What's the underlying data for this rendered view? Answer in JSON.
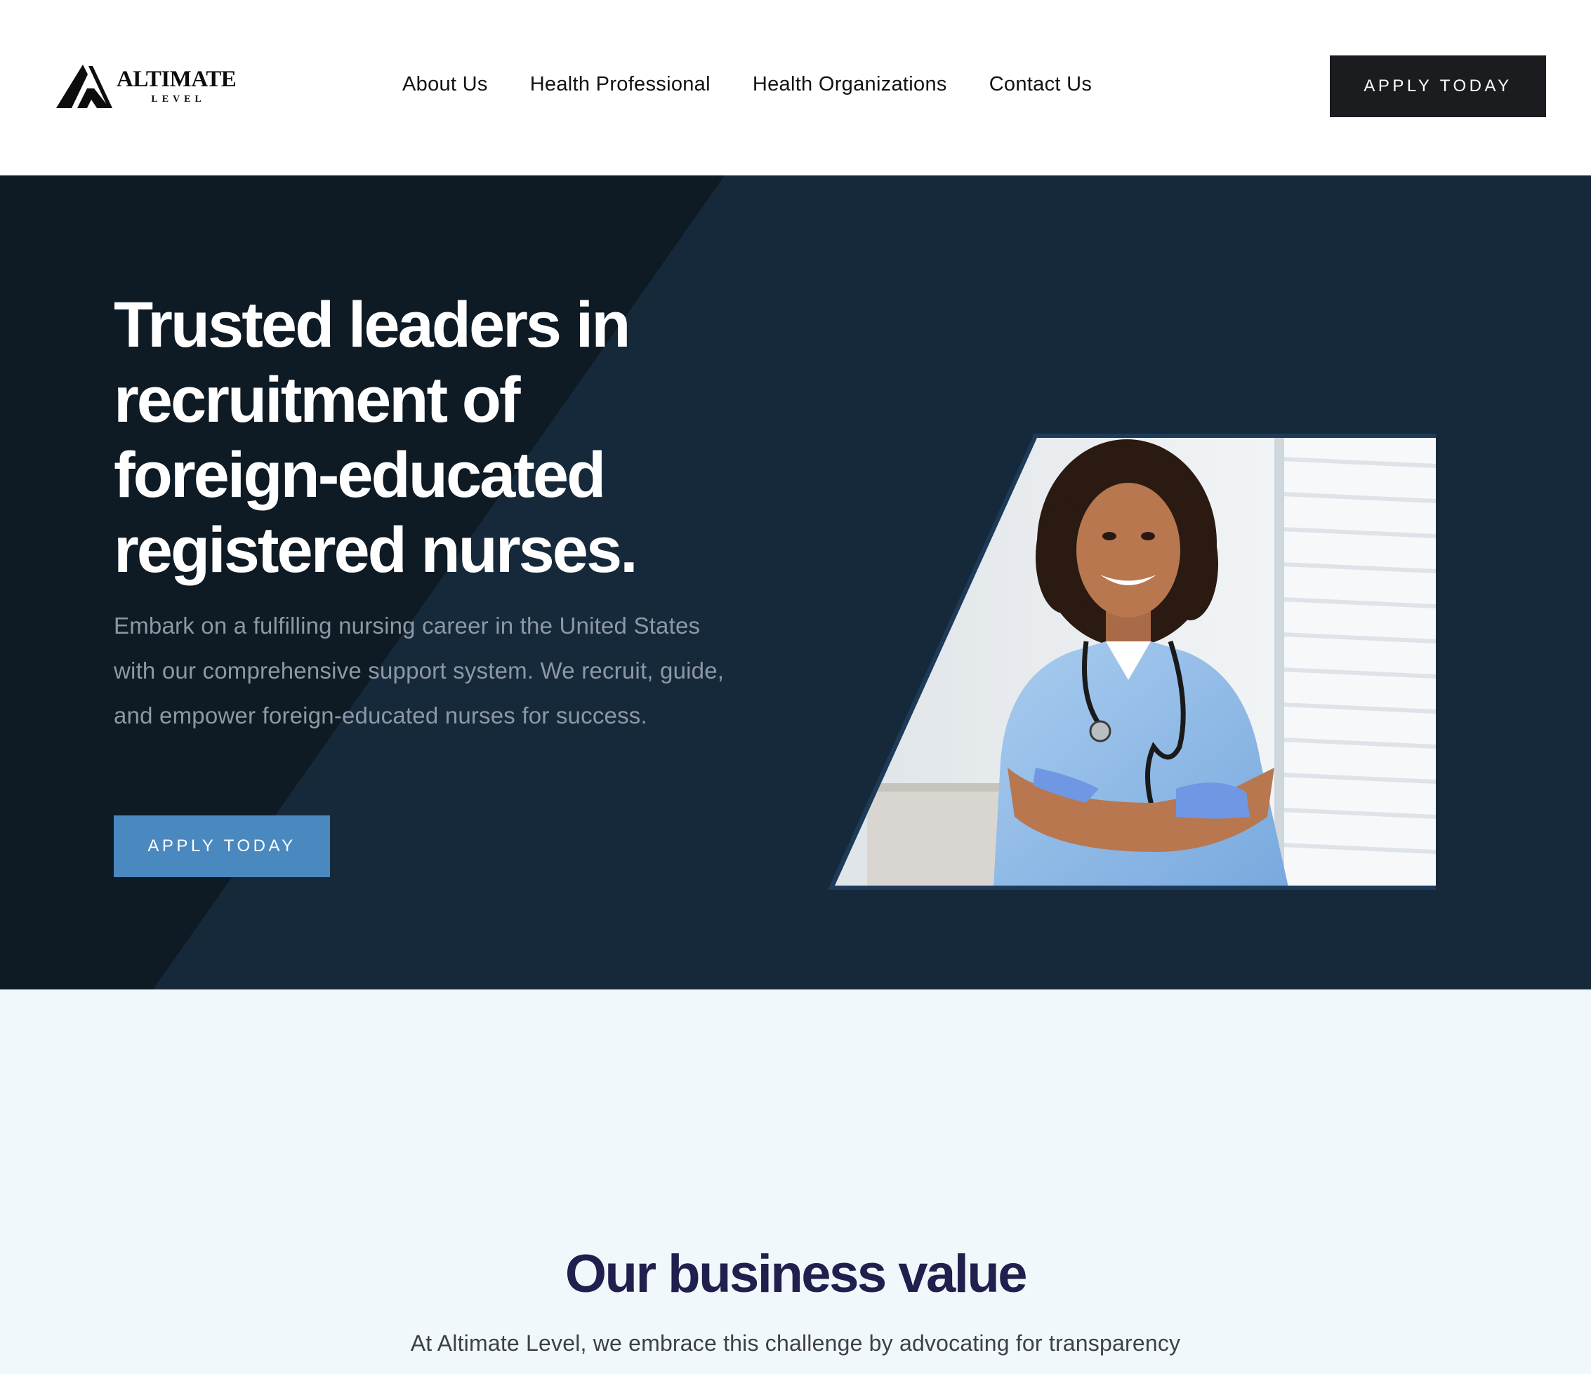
{
  "brand": {
    "name": "ALTIMATE",
    "tagline": "LEVEL",
    "logo_icon": "mountain-a-logo-icon"
  },
  "nav": {
    "items": [
      {
        "label": "About Us"
      },
      {
        "label": "Health Professional"
      },
      {
        "label": "Health Organizations"
      },
      {
        "label": "Contact Us"
      }
    ],
    "cta_label": "APPLY TODAY"
  },
  "hero": {
    "title": "Trusted leaders in recruitment of foreign-educated registered nurses.",
    "body": "Embark on a fulfilling nursing career in the United States with our comprehensive support system. We recruit, guide, and empower foreign-educated nurses for success.",
    "cta_label": "APPLY TODAY",
    "image_icon": "smiling-nurse-photo"
  },
  "value": {
    "title": "Our business value",
    "body": "At Altimate Level, we embrace this challenge by advocating for transparency"
  },
  "colors": {
    "header_cta_bg": "#1b1c20",
    "hero_bg": "#172b3d",
    "hero_cta_bg": "#4a88c0",
    "value_bg": "#f1f8fb",
    "value_title": "#211f4d"
  }
}
